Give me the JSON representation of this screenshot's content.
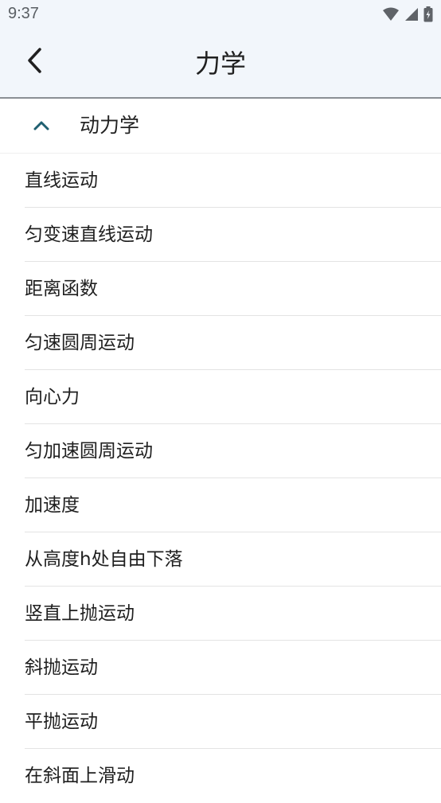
{
  "status_bar": {
    "time": "9:37"
  },
  "app_bar": {
    "title": "力学",
    "back_icon": "chevron-left-icon"
  },
  "section": {
    "label": "动力学",
    "expanded": true,
    "toggle_icon": "chevron-up-icon"
  },
  "items": [
    {
      "label": "直线运动"
    },
    {
      "label": "匀变速直线运动"
    },
    {
      "label": "距离函数"
    },
    {
      "label": "匀速圆周运动"
    },
    {
      "label": "向心力"
    },
    {
      "label": "匀加速圆周运动"
    },
    {
      "label": "加速度"
    },
    {
      "label": "从高度h处自由下落"
    },
    {
      "label": "竖直上抛运动"
    },
    {
      "label": "斜抛运动"
    },
    {
      "label": "平抛运动"
    },
    {
      "label": "在斜面上滑动"
    }
  ],
  "colors": {
    "accent": "#1f5f70",
    "top_background": "#f2f6fb",
    "divider": "#e3e3e3"
  }
}
